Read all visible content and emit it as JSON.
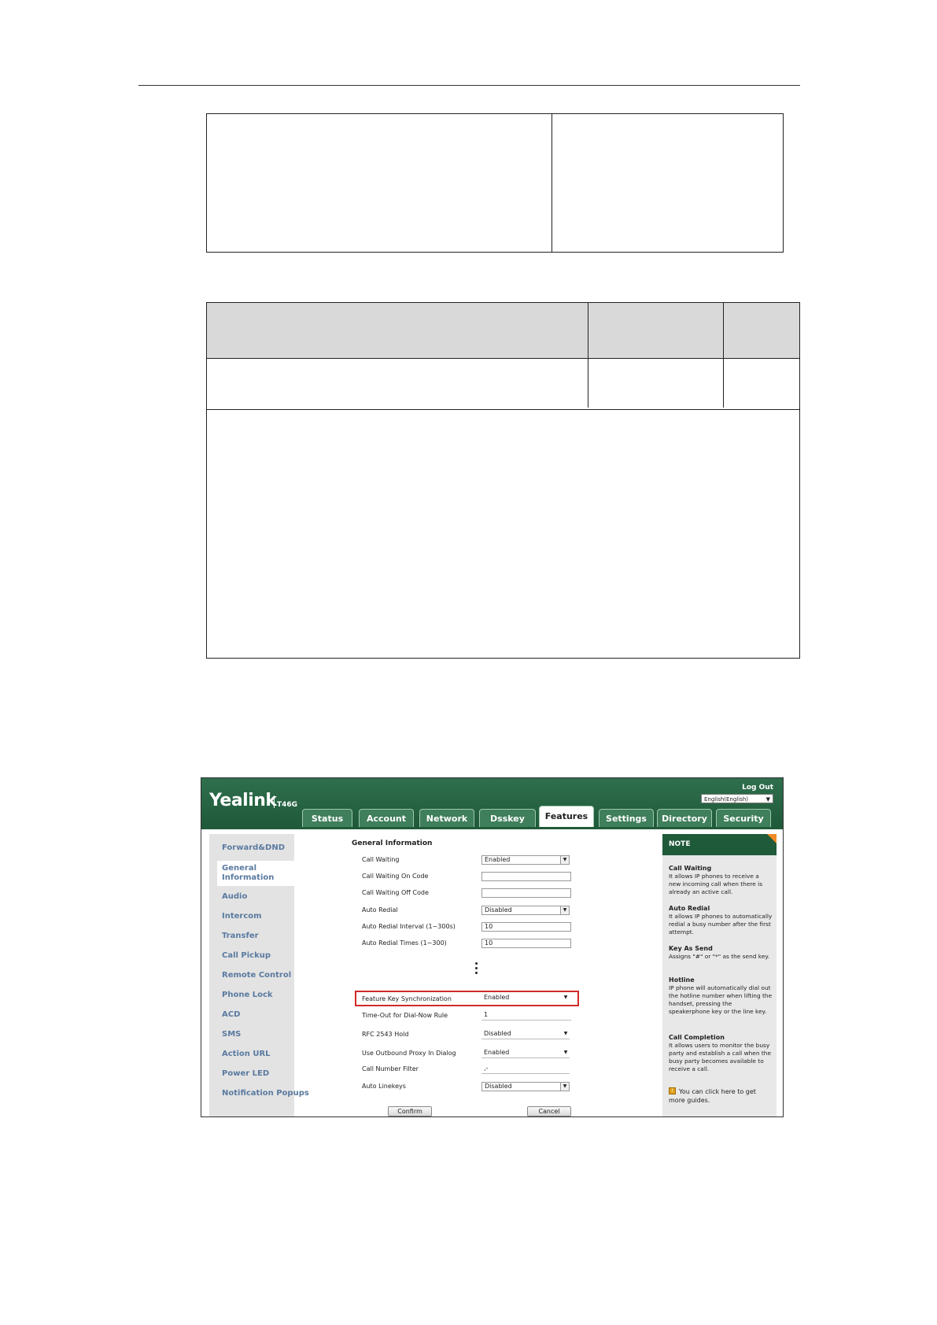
{
  "webui": {
    "logo": "Yealink",
    "model": "T46G",
    "logout": "Log Out",
    "language": "English(English)",
    "tabs": [
      "Status",
      "Account",
      "Network",
      "Dsskey",
      "Features",
      "Settings",
      "Directory",
      "Security"
    ],
    "active_tab": "Features",
    "sidebar": [
      "Forward&DND",
      "General Information",
      "Audio",
      "Intercom",
      "Transfer",
      "Call Pickup",
      "Remote Control",
      "Phone Lock",
      "ACD",
      "SMS",
      "Action URL",
      "Power LED",
      "Notification Popups"
    ],
    "section_title": "General Information",
    "fields": [
      {
        "label": "Call Waiting",
        "value": "Enabled"
      },
      {
        "label": "Call Waiting On Code",
        "value": ""
      },
      {
        "label": "Call Waiting Off Code",
        "value": ""
      },
      {
        "label": "Auto Redial",
        "value": "Disabled"
      },
      {
        "label": "Auto Redial Interval (1~300s)",
        "value": "10"
      },
      {
        "label": "Auto Redial Times (1~300)",
        "value": "10"
      },
      {
        "label": "Feature Key Synchronization",
        "value": "Enabled"
      },
      {
        "label": "Time-Out for Dial-Now Rule",
        "value": "1"
      },
      {
        "label": "RFC 2543 Hold",
        "value": "Disabled"
      },
      {
        "label": "Use Outbound Proxy In Dialog",
        "value": "Enabled"
      },
      {
        "label": "Call Number Filter",
        "value": ",-"
      },
      {
        "label": "Auto Linekeys",
        "value": "Disabled"
      }
    ],
    "buttons": {
      "confirm": "Confirm",
      "cancel": "Cancel"
    },
    "note": {
      "title": "NOTE",
      "entries": [
        {
          "title": "Call Waiting",
          "body": "It allows IP phones to receive a new incoming call when there is already an active call."
        },
        {
          "title": "Auto Redial",
          "body": "It allows IP phones to automatically redial a busy number after the first attempt."
        },
        {
          "title": "Key As Send",
          "body": "Assigns \"#\" or \"*\" as the send key."
        },
        {
          "title": "Hotline",
          "body": "IP phone will automatically dial out the hotline number when lifting the handset, pressing the speakerphone key or the line key."
        },
        {
          "title": "Call Completion",
          "body": "It allows users to monitor the busy party and establish a call when the busy party becomes available to receive a call."
        }
      ],
      "guide": "You can click here to get more guides."
    }
  }
}
